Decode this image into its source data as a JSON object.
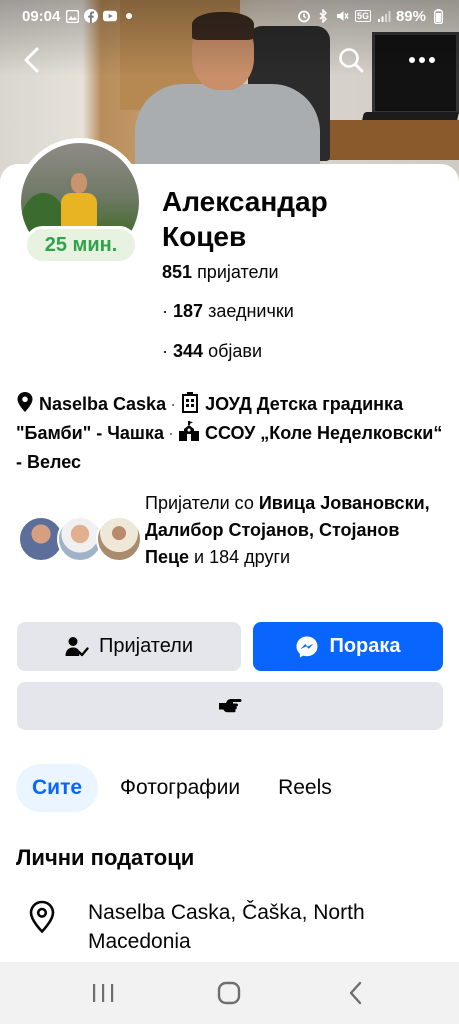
{
  "status_bar": {
    "time": "09:04",
    "left_icons": [
      "gallery-icon",
      "facebook-icon",
      "youtube-icon",
      "dot-icon"
    ],
    "right_icons": [
      "alarm-icon",
      "bluetooth-icon",
      "mute-icon",
      "5g-icon",
      "signal-icon"
    ],
    "network": "5G",
    "battery": "89%"
  },
  "profile": {
    "name": "Александар Коцев",
    "active_time": "25 мин.",
    "friends_count": "851",
    "friends_label": "пријатели",
    "mutual_count": "187",
    "mutual_label": "заеднички",
    "posts_count": "344",
    "posts_label": "објави"
  },
  "details": {
    "location": "Naselba Caska",
    "work1": "ЈОУД Детска градинка \"Бамби\" - Чашка",
    "school": "ССОУ „Коле Неделковски“ - Велес"
  },
  "mutual_friends": {
    "prefix": "Пријатели со",
    "names": "Ивица Јовановски, Далибор Стојанов, Стојанов Пеце",
    "joiner": "и",
    "others": "184 други"
  },
  "actions": {
    "friends_label": "Пријатели",
    "message_label": "Порака"
  },
  "tabs": [
    "Сите",
    "Фотографии",
    "Reels"
  ],
  "personal_info": {
    "title": "Лични податоци",
    "place": "Naselba Caska, Čaška, North Macedonia"
  },
  "colors": {
    "brand_blue": "#0866ff",
    "active_green": "#31a24c",
    "button_gray": "#e4e6eb"
  }
}
